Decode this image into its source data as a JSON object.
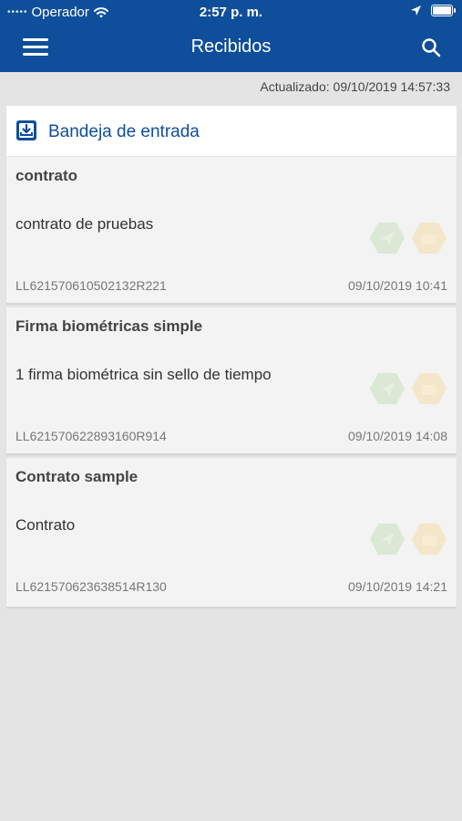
{
  "status_bar": {
    "carrier": "Operador",
    "time": "2:57 p. m."
  },
  "nav": {
    "title": "Recibidos"
  },
  "updated_text": "Actualizado: 09/10/2019 14:57:33",
  "inbox": {
    "label": "Bandeja de entrada"
  },
  "items": [
    {
      "title": "contrato",
      "description": "contrato de pruebas",
      "code": "LL621570610502132R221",
      "date": "09/10/2019 10:41"
    },
    {
      "title": "Firma biométricas simple",
      "description": "1 firma biométrica sin sello de tiempo",
      "code": "LL621570622893160R914",
      "date": "09/10/2019 14:08"
    },
    {
      "title": "Contrato sample",
      "description": "Contrato",
      "code": "LL621570623638514R130",
      "date": "09/10/2019 14:21"
    }
  ],
  "colors": {
    "brand_blue": "#0f4e9a",
    "background": "#e4e4e4",
    "card": "#f3f3f3",
    "hex_green": "#cfe3c7",
    "hex_orange": "#f2dfb8"
  }
}
